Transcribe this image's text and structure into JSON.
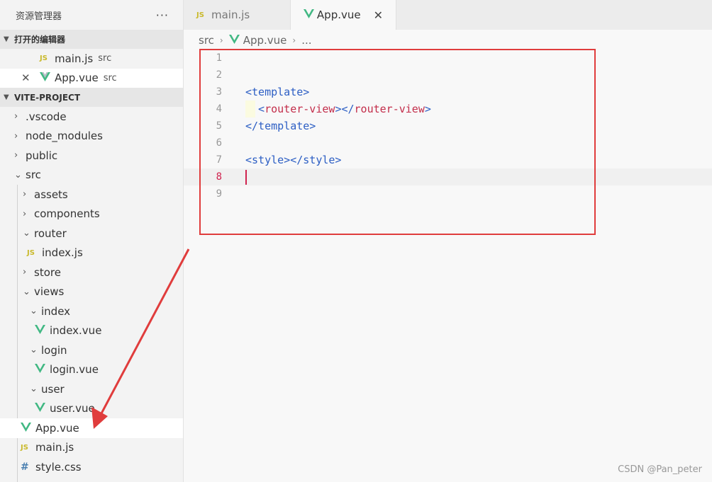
{
  "sidebar": {
    "title": "资源管理器",
    "more": "···",
    "open_editors_header": "打开的编辑器",
    "open_editors": [
      {
        "name": "main.js",
        "dir": "src",
        "icon": "js-icon"
      },
      {
        "name": "App.vue",
        "dir": "src",
        "icon": "vue-icon"
      }
    ],
    "project_header": "VITE-PROJECT",
    "tree": {
      "vscode": ".vscode",
      "node_modules": "node_modules",
      "public": "public",
      "src": "src",
      "assets": "assets",
      "components": "components",
      "router": "router",
      "router_index": "index.js",
      "store": "store",
      "views": "views",
      "index": "index",
      "index_vue": "index.vue",
      "login": "login",
      "login_vue": "login.vue",
      "user": "user",
      "user_vue": "user.vue",
      "app_vue": "App.vue",
      "main_js": "main.js",
      "style_css": "style.css"
    }
  },
  "tabs": [
    {
      "label": "main.js",
      "icon": "js-icon",
      "active": false
    },
    {
      "label": "App.vue",
      "icon": "vue-icon",
      "active": true
    }
  ],
  "icons": {
    "js": "JS",
    "hash": "#",
    "close": "✕",
    "chevron_right": "›",
    "chevron_down": "⌄"
  },
  "breadcrumb": {
    "src": "src",
    "file": "App.vue",
    "ellipsis": "..."
  },
  "editor": {
    "lines": [
      {
        "n": "1",
        "open": "",
        "tag": "",
        "mid": "",
        "close": ""
      },
      {
        "n": "2",
        "open": "",
        "tag": "",
        "mid": "",
        "close": ""
      },
      {
        "n": "3",
        "open": "<template>",
        "tag": "",
        "mid": "",
        "close": ""
      },
      {
        "n": "4",
        "open": "  <",
        "tag": "router-view",
        "mid": "></",
        "close": "router-view"
      },
      {
        "n": "5",
        "open": "</template>",
        "tag": "",
        "mid": "",
        "close": ""
      },
      {
        "n": "6",
        "open": "",
        "tag": "",
        "mid": "",
        "close": ""
      },
      {
        "n": "7",
        "open": "<style></style>",
        "tag": "",
        "mid": "",
        "close": ""
      },
      {
        "n": "8",
        "open": "",
        "tag": "",
        "mid": "",
        "close": ""
      },
      {
        "n": "9",
        "open": "",
        "tag": "",
        "mid": "",
        "close": ""
      }
    ],
    "line4_end": ">"
  },
  "colors": {
    "annotation_red": "#e03c3c",
    "vue_green": "#41b883",
    "tag_blue": "#2c5ec4",
    "keyword_red": "#c32d4a"
  },
  "watermark": "CSDN @Pan_peter"
}
